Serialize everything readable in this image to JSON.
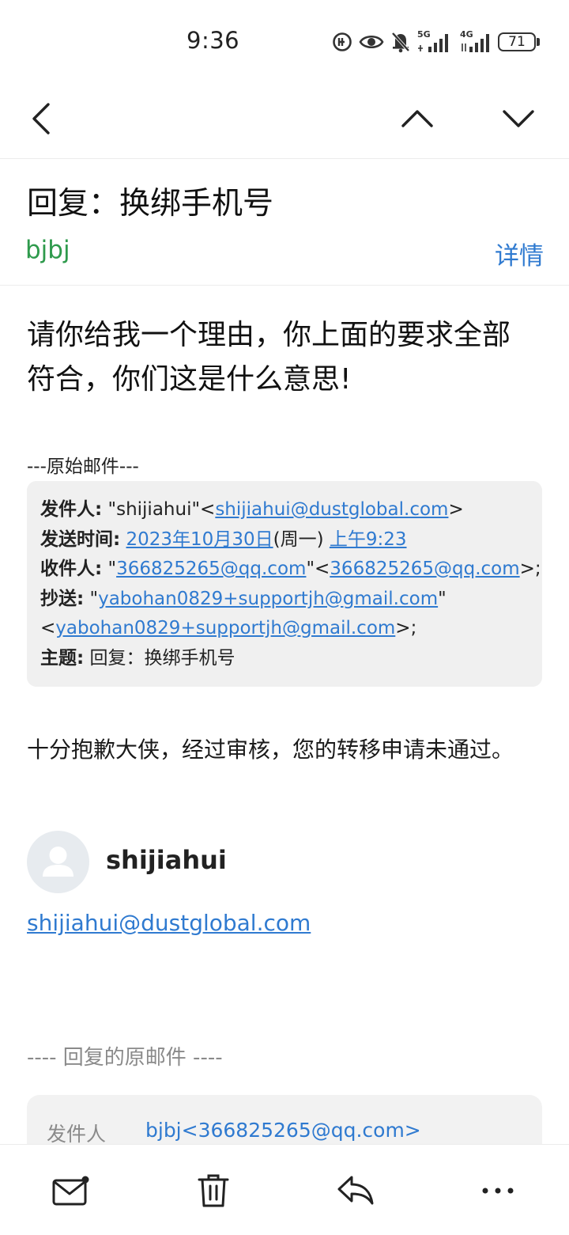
{
  "status_bar": {
    "time": "9:36",
    "network_5g": "5G",
    "network_4g": "4G",
    "battery": "71",
    "icons": [
      "data-saver-icon",
      "eye-icon",
      "mute-icon",
      "signal-5g-icon",
      "signal-4g-icon",
      "battery-icon"
    ]
  },
  "nav": {
    "icons": [
      "back-arrow-icon",
      "chevron-up-icon",
      "chevron-down-icon"
    ]
  },
  "email": {
    "subject": "回复：换绑手机号",
    "sender": "bjbj",
    "details_label": "详情",
    "body_line1": "请你给我一个理由，你上面的要求全部",
    "body_line2": "符合，你们这是什么意思!",
    "original_label": "---原始邮件---"
  },
  "quoted": {
    "from_label": "发件人:",
    "from_name": " \"shijiahui\"<",
    "from_email": "shijiahui@dustglobal.com",
    "from_close": ">",
    "sent_label": "发送时间:",
    "sent_date": "2023年10月30日",
    "sent_weekday": "(周一) ",
    "sent_time": "上午9:23",
    "to_label": "收件人:",
    "to_quote_open": " \"",
    "to_name": "366825265@qq.com",
    "to_mid": "\"<",
    "to_email": "366825265@qq.com",
    "to_close": ">;",
    "cc_label": "抄送:",
    "cc_quote_open": " \"",
    "cc_name": "yabohan0829+supportjh@gmail.com",
    "cc_quote_close": "\"",
    "cc_open": "<",
    "cc_email": "yabohan0829+supportjh@gmail.com",
    "cc_close": ">;",
    "subject_label": "主题:",
    "subject_value": " 回复：换绑手机号"
  },
  "reply": {
    "text": "十分抱歉大侠，经过审核，您的转移申请未通过。"
  },
  "signature": {
    "name": "shijiahui",
    "email": "shijiahui@dustglobal.com"
  },
  "original": {
    "separator": "---- 回复的原邮件 ----",
    "from_label": "发件人",
    "from_value": "bjbj<366825265@qq.com>"
  },
  "bottom_bar": {
    "icons": [
      "mail-icon",
      "trash-icon",
      "reply-icon",
      "more-icon"
    ]
  },
  "colors": {
    "sender_green": "#2e9a4c",
    "link_blue": "#2f7ad0",
    "quote_bg": "#f0f0f0"
  }
}
